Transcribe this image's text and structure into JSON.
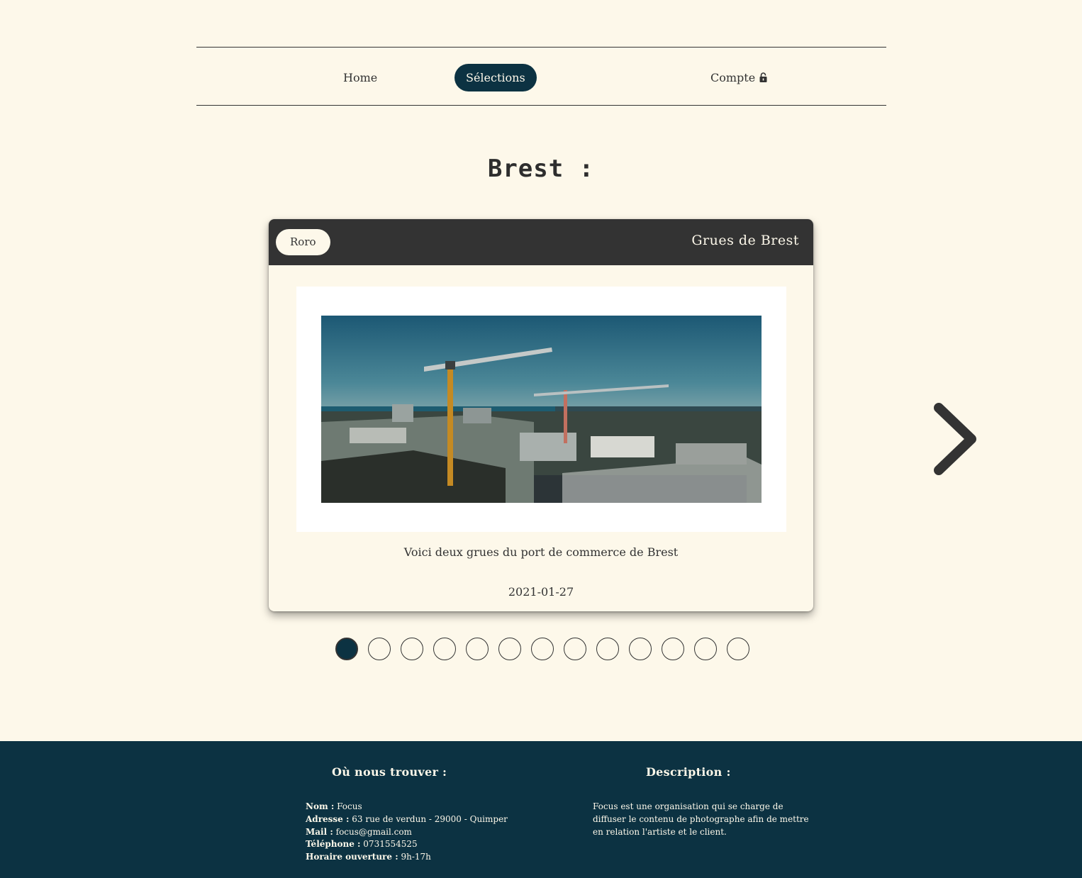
{
  "nav": {
    "home_label": "Home",
    "selections_label": "Sélections",
    "compte_label": "Compte",
    "active": "selections",
    "compte_icon": "lock-icon"
  },
  "page_title": "Brest :",
  "card": {
    "author": "Roro",
    "title": "Grues de Brest",
    "description": "Voici deux grues du port de commerce de Brest",
    "date": "2021-01-27",
    "image_subject": "port cranes over Brest harbor"
  },
  "carousel": {
    "total_slides": 13,
    "active_index": 0,
    "next_icon": "chevron-right-icon"
  },
  "footer": {
    "where_heading": "Où nous trouver :",
    "description_heading": "Description :",
    "contact": {
      "name_label": "Nom :",
      "name_value": "Focus",
      "address_label": "Adresse :",
      "address_value": "63 rue de verdun - 29000 - Quimper",
      "mail_label": "Mail :",
      "mail_value": "focus@gmail.com",
      "phone_label": "Téléphone :",
      "phone_value": "0731554525",
      "hours_label": "Horaire ouverture :",
      "hours_value": "9h-17h"
    },
    "description_text": "Focus est une organisation qui se charge de diffuser le contenu de photographe afin de mettre en relation l'artiste et le client."
  },
  "colors": {
    "background": "#fdf8ea",
    "primary": "#0c3242",
    "card_header": "#333333"
  }
}
